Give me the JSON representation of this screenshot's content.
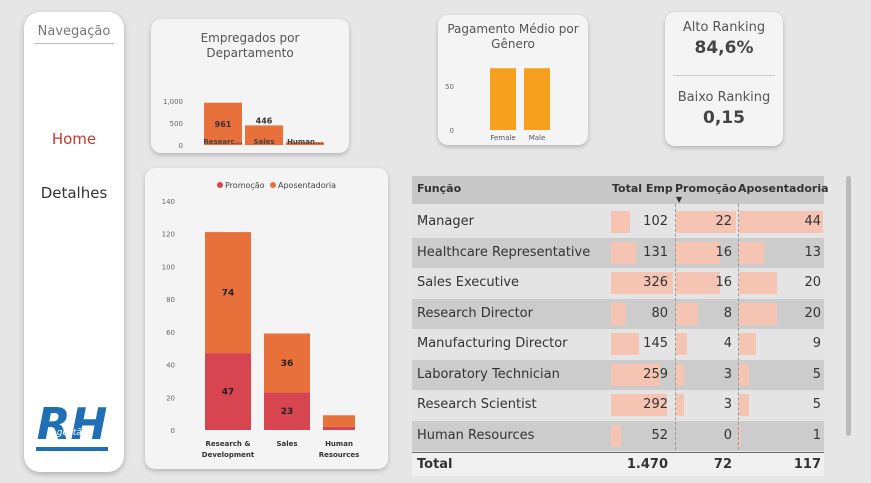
{
  "nav": {
    "title": "Navegação",
    "home": "Home",
    "details": "Detalhes",
    "logo_text": "RH",
    "logo_sub": "gestão"
  },
  "colors": {
    "accent": "#e8703a",
    "promo": "#d64550",
    "bar": "#f5c4b3",
    "gender": "#f7a01d"
  },
  "kpi": {
    "high_label": "Alto Ranking",
    "high_value": "84,6%",
    "low_label": "Baixo Ranking",
    "low_value": "0,15"
  },
  "chart_data": [
    {
      "type": "bar",
      "title": "Empregados por Departamento",
      "categories": [
        "Researc...",
        "Sales",
        "Human..."
      ],
      "values": [
        961,
        446,
        63
      ],
      "data_labels": [
        "961",
        "446",
        ""
      ],
      "yticks": [
        "1,000",
        "500",
        "0"
      ],
      "ylim": [
        0,
        1000
      ]
    },
    {
      "type": "bar",
      "title": "Pagamento Médio por Gênero",
      "categories": [
        "Female",
        "Male"
      ],
      "values": [
        65,
        65
      ],
      "yticks": [
        "50",
        "0"
      ],
      "ylim": [
        0,
        80
      ]
    },
    {
      "type": "bar",
      "stacked": true,
      "legend": "top-center",
      "categories": [
        "Research & Development",
        "Sales",
        "Human Resources"
      ],
      "series": [
        {
          "name": "Promoção",
          "values": [
            47,
            23,
            2
          ],
          "labels": [
            "47",
            "23",
            ""
          ]
        },
        {
          "name": "Aposentadoria",
          "values": [
            74,
            36,
            7
          ],
          "labels": [
            "74",
            "36",
            ""
          ]
        }
      ],
      "yticks": [
        "140",
        "120",
        "100",
        "80",
        "60",
        "40",
        "20",
        "0"
      ],
      "ylim": [
        0,
        140
      ]
    }
  ],
  "table": {
    "headers": [
      "Função",
      "Total Emp",
      "Promoção",
      "Aposentadoria"
    ],
    "rows": [
      {
        "name": "Manager",
        "total": 102,
        "promo": 22,
        "apos": 44
      },
      {
        "name": "Healthcare Representative",
        "total": 131,
        "promo": 16,
        "apos": 13
      },
      {
        "name": "Sales Executive",
        "total": 326,
        "promo": 16,
        "apos": 20
      },
      {
        "name": "Research Director",
        "total": 80,
        "promo": 8,
        "apos": 20
      },
      {
        "name": "Manufacturing Director",
        "total": 145,
        "promo": 4,
        "apos": 9
      },
      {
        "name": "Laboratory Technician",
        "total": 259,
        "promo": 3,
        "apos": 5
      },
      {
        "name": "Research Scientist",
        "total": 292,
        "promo": 3,
        "apos": 5
      },
      {
        "name": "Human Resources",
        "total": 52,
        "promo": 0,
        "apos": 1
      }
    ],
    "total_label": "Total",
    "total_emp": "1.470",
    "total_promo": "72",
    "total_apos": "117"
  }
}
